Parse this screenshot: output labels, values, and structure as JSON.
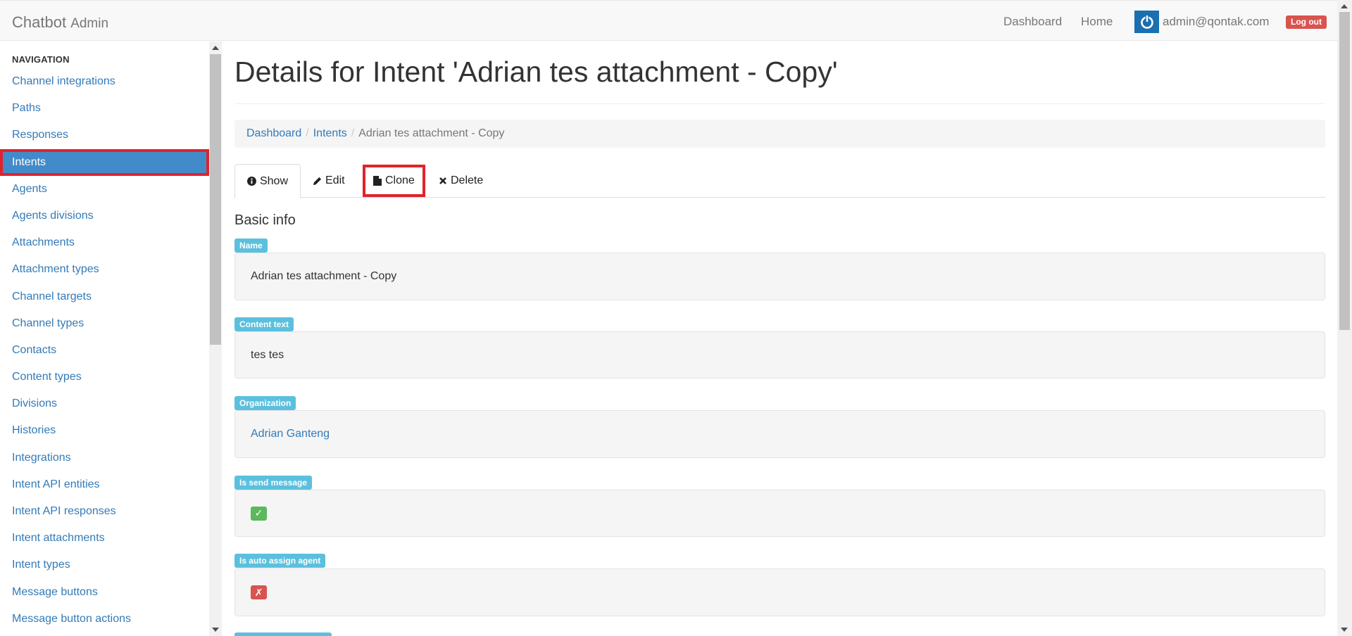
{
  "navbar": {
    "brand": "Chatbot",
    "brand_sub": "Admin",
    "links": {
      "dashboard": "Dashboard",
      "home": "Home"
    },
    "user_email": "admin@qontak.com",
    "logout_label": "Log out"
  },
  "sidebar": {
    "header": "NAVIGATION",
    "items": [
      {
        "label": "Channel integrations"
      },
      {
        "label": "Paths"
      },
      {
        "label": "Responses"
      },
      {
        "label": "Intents",
        "active": true
      },
      {
        "label": "Agents"
      },
      {
        "label": "Agents divisions"
      },
      {
        "label": "Attachments"
      },
      {
        "label": "Attachment types"
      },
      {
        "label": "Channel targets"
      },
      {
        "label": "Channel types"
      },
      {
        "label": "Contacts"
      },
      {
        "label": "Content types"
      },
      {
        "label": "Divisions"
      },
      {
        "label": "Histories"
      },
      {
        "label": "Integrations"
      },
      {
        "label": "Intent API entities"
      },
      {
        "label": "Intent API responses"
      },
      {
        "label": "Intent attachments"
      },
      {
        "label": "Intent types"
      },
      {
        "label": "Message buttons"
      },
      {
        "label": "Message button actions"
      }
    ]
  },
  "main": {
    "title": "Details for Intent 'Adrian tes attachment - Copy'",
    "breadcrumb": {
      "dashboard": "Dashboard",
      "intents": "Intents",
      "current": "Adrian tes attachment - Copy"
    },
    "tabs": {
      "show": "Show",
      "edit": "Edit",
      "clone": "Clone",
      "delete": "Delete"
    },
    "section_title": "Basic info",
    "fields": {
      "name": {
        "label": "Name",
        "value": "Adrian tes attachment - Copy"
      },
      "content_text": {
        "label": "Content text",
        "value": "tes tes"
      },
      "organization": {
        "label": "Organization",
        "value": "Adrian Ganteng"
      },
      "is_send_message": {
        "label": "Is send message",
        "value": "✓"
      },
      "is_auto_assign_agent": {
        "label": "Is auto assign agent",
        "value": "✗"
      }
    }
  },
  "colors": {
    "primary": "#337ab7",
    "active_nav": "#428bca",
    "label_info": "#5bc0de",
    "success": "#5cb85c",
    "danger": "#d9534f",
    "highlight": "#e0222b"
  }
}
